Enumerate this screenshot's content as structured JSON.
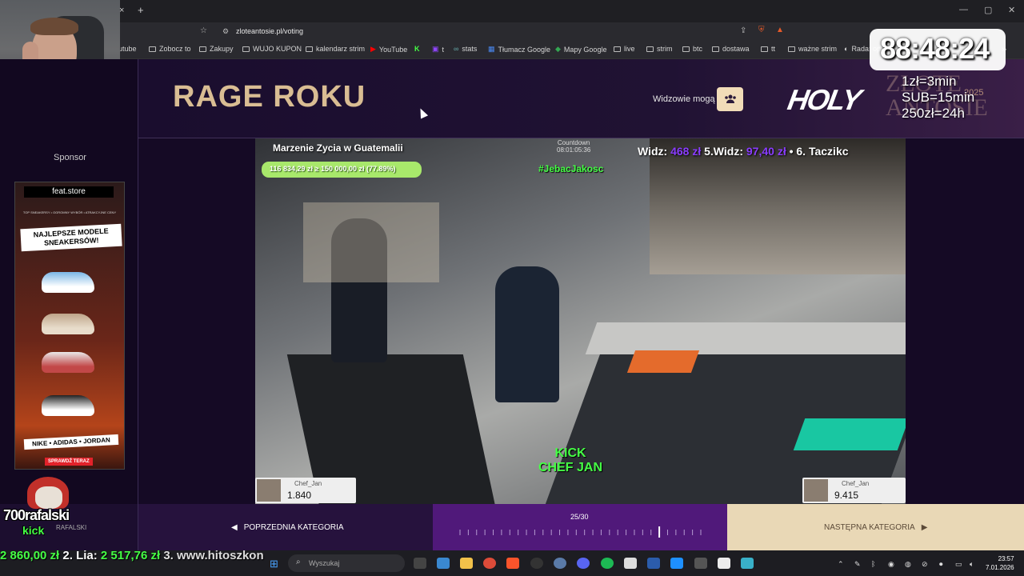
{
  "browser": {
    "url": "zloteantosie.pl/voting",
    "close_tab": "×",
    "new_tab": "+",
    "bookmarks": [
      "utube",
      "Zobocz to",
      "Zakupy",
      "WUJO KUPON",
      "kalendarz strim",
      "YouTube",
      "t",
      "stats",
      "Tłumacz Google",
      "Mapy Google",
      "live",
      "strim",
      "btc",
      "dostawa",
      "tt",
      "ważne strim",
      "Rada: opo"
    ],
    "more": "»"
  },
  "overlay": {
    "timer": "88:48:24",
    "rates": [
      "1zł=3min",
      "SUB=15min",
      "250zł=24h"
    ],
    "holy": "HOLY",
    "zlote": "ZŁOTE ANTOSIE",
    "year": "2025"
  },
  "page": {
    "title": "RAGE ROKU",
    "vote_text": "Widzowie mogą",
    "sponsor_label": "Sponsor"
  },
  "stream": {
    "header": "Marzenie Zycia w Guatemalii",
    "goal": "116 834,29 zł ≥ 150 000,00 zł (77.89%)",
    "countdown_label": "Countdown",
    "countdown_value": "08:01:05:36",
    "hashtag": "#JebacJakosc",
    "ticker_a": "Widz: ",
    "ticker_a_val": "468 zł",
    "ticker_b": " 5.Widz: ",
    "ticker_b_val": "97,40 zł",
    "ticker_c": " • 6. Taczikc",
    "kick_line1": "KICK",
    "kick_line2": "CHEF JAN",
    "card_left_name": "Chef_Jan",
    "card_left_value": "1.840",
    "card_right_name": "Chef_Jan",
    "card_right_value": "9.415"
  },
  "ad": {
    "brand": "feat.store",
    "tagline": "TOP SNEAKERSY • OGROMNY WYBÓR • ATRAKCYJNE CENY",
    "headline": "NAJLEPSZE MODELE SNEAKERSÓW!",
    "brands": "NIKE • ADIDAS • JORDAN",
    "cta": "SPRAWDŹ TERAZ"
  },
  "nav": {
    "prev": "POPRZEDNIA KATEGORIA",
    "progress": "25/30",
    "next": "NASTĘPNA KATEGORIA"
  },
  "progress": {
    "current": 25,
    "total": 30
  },
  "streamer": {
    "name": "700rafalski",
    "kick": "kick",
    "under": "RAFALSKI"
  },
  "bottom_ticker": {
    "p1_val": "2 860,00 zł",
    "p2": "  2. Lia: ",
    "p2_val": "2 517,76 zł",
    "p3": "   3. www.hitoszkon"
  },
  "taskbar": {
    "search": "Wyszukaj",
    "time": "23:57",
    "date": "7.01.2026"
  },
  "colors": {
    "accent_gold": "#d9bd93",
    "page_bg": "#150a25",
    "kick_green": "#45ff45",
    "nav_mid": "#50197a"
  }
}
